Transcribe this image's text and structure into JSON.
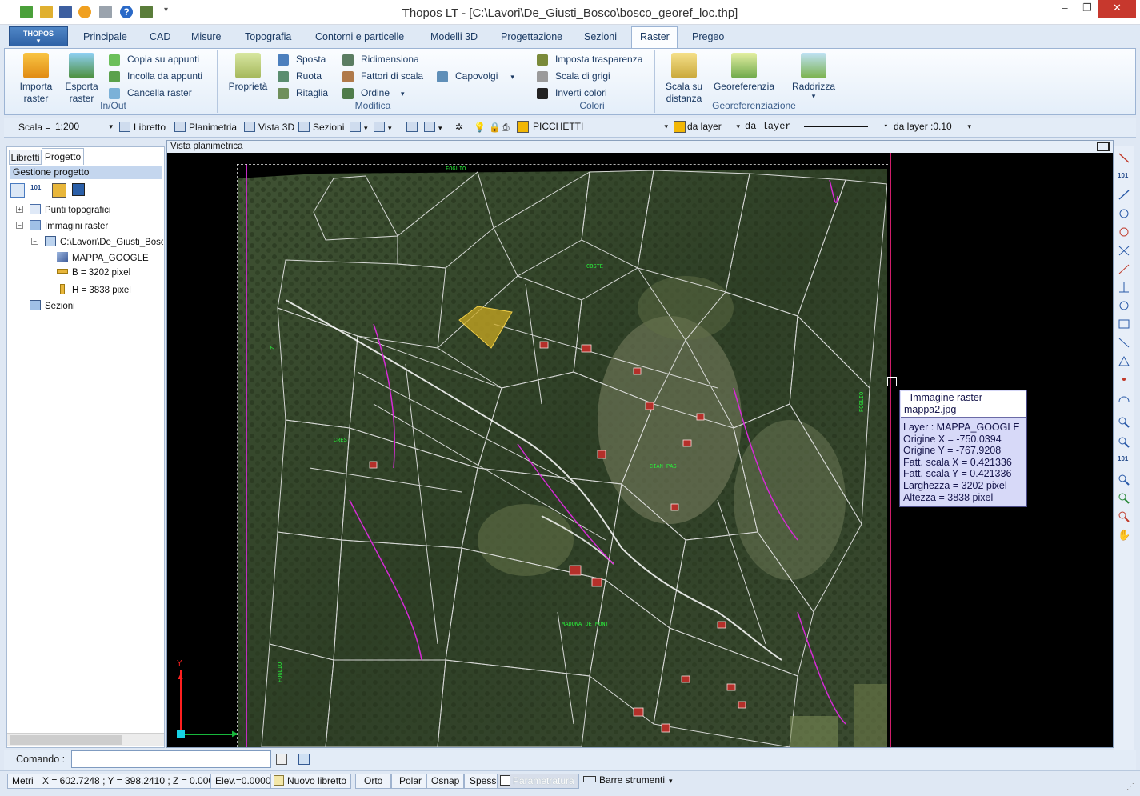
{
  "window": {
    "title": "Thopos LT - [C:\\Lavori\\De_Giusti_Bosco\\bosco_georef_loc.thp]"
  },
  "app_button": {
    "label": "THOPOS"
  },
  "ribbon": {
    "tabs": [
      "Principale",
      "CAD",
      "Misure",
      "Topografia",
      "Contorni e particelle",
      "Modelli 3D",
      "Progettazione",
      "Sezioni",
      "Raster",
      "Pregeo"
    ],
    "active_tab": "Raster",
    "groups": {
      "inout": {
        "title": "In/Out",
        "importa": [
          "Importa",
          "raster"
        ],
        "esporta": [
          "Esporta",
          "raster"
        ],
        "copia": "Copia su appunti",
        "incolla": "Incolla da appunti",
        "cancella": "Cancella raster"
      },
      "modifica": {
        "title": "Modifica",
        "proprieta": "Proprietà",
        "sposta": "Sposta",
        "ruota": "Ruota",
        "ritaglia": "Ritaglia",
        "ridimensiona": "Ridimensiona",
        "fattori": "Fattori di scala",
        "ordine": "Ordine",
        "capovolgi": "Capovolgi"
      },
      "colori": {
        "title": "Colori",
        "trasparenza": "Imposta trasparenza",
        "grigi": "Scala di grigi",
        "inverti": "Inverti colori"
      },
      "georef": {
        "title": "Georeferenziazione",
        "scala": [
          "Scala su",
          "distanza"
        ],
        "georeferenzia": "Georeferenzia",
        "raddrizza": "Raddrizza"
      }
    }
  },
  "display_toolbar": {
    "scala_label": "Scala =",
    "scala_value": "1:200",
    "libretto": "Libretto",
    "planimetria": "Planimetria",
    "vista3d": "Vista 3D",
    "sezioni": "Sezioni",
    "layer": "PICCHETTI",
    "color_mode": "da layer",
    "linetype": "da layer",
    "lineweight": "da layer :0.10",
    "layer_color": "#f2b705"
  },
  "left_panel": {
    "tabs": [
      "Libretti",
      "Progetto"
    ],
    "active_tab": "Progetto",
    "header": "Gestione progetto",
    "tree": {
      "punti": "Punti topografici",
      "immagini": "Immagini raster",
      "file": "C:\\Lavori\\De_Giusti_Bosco",
      "layer": "MAPPA_GOOGLE",
      "b": "B = 3202 pixel",
      "h": "H = 3838 pixel",
      "sezioni": "Sezioni"
    }
  },
  "map": {
    "title": "Vista planimetrica",
    "axis_y": "Y",
    "labels": {
      "foglio_top": "FOGLIO",
      "costi": "COSTE",
      "cres": "CRES",
      "ciampas": "CIAN PAS",
      "madonna": "MADONA DE MONT",
      "foglio_left": "FOGLIO",
      "foglio_right": "FOGLIO",
      "z": "Z"
    }
  },
  "tooltip": {
    "line1": "- Immagine raster -",
    "line2": "mappa2.jpg",
    "layer": "Layer : MAPPA_GOOGLE",
    "origine_x": "Origine X = -750.0394",
    "origine_y": "Origine Y = -767.9208",
    "fatt_x": "Fatt. scala X = 0.421336",
    "fatt_y": "Fatt. scala Y = 0.421336",
    "larghezza": "Larghezza = 3202 pixel",
    "altezza": "Altezza = 3838 pixel"
  },
  "command": {
    "label": "Comando :",
    "value": ""
  },
  "statusbar": {
    "unit": "Metri",
    "coords": "X = 602.7248 ; Y = 398.2410 ; Z = 0.0000",
    "elev": "Elev.=0.0000",
    "nuovo": "Nuovo libretto",
    "orto": "Orto",
    "polar": "Polar",
    "osnap": "Osnap",
    "spess": "Spess",
    "param": "Parametratura",
    "barre": "Barre strumenti"
  }
}
